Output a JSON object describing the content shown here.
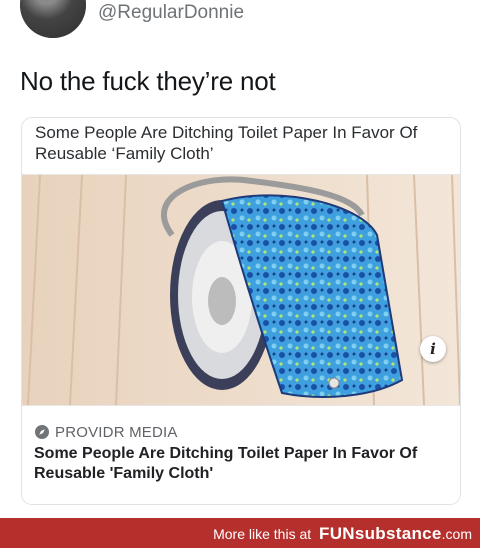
{
  "tweet": {
    "handle": "@RegularDonnie",
    "text": "No the fuck they’re not"
  },
  "card": {
    "top_title": "Some People Are Ditching Toilet Paper In Favor Of Reusable ‘Family Cloth’",
    "image_icon": "info-icon",
    "info_glyph": "i",
    "provider": "PROVIDR MEDIA",
    "bottom_title": "Some People Are Ditching Toilet Paper In Favor Of Reusable 'Family Cloth'"
  },
  "footer": {
    "prefix": "More like this at",
    "brand": "FUNsubstance",
    "suffix": ".com",
    "color": "#b5302c"
  }
}
